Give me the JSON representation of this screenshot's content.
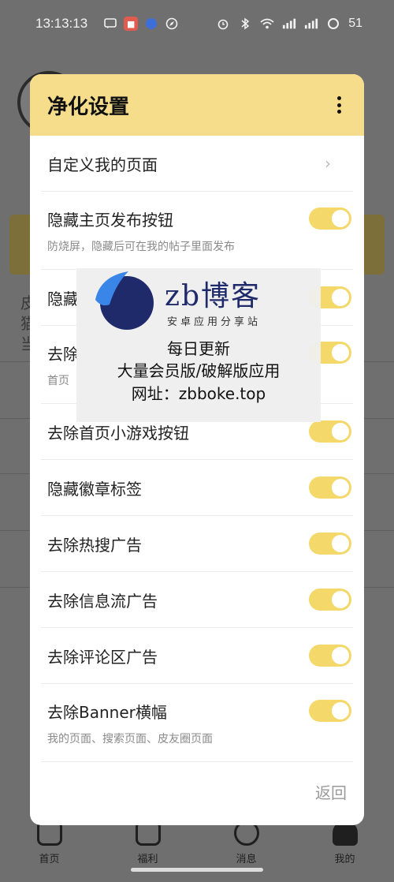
{
  "status_bar": {
    "time": "13:13:13",
    "battery": "51"
  },
  "background_app": {
    "snippets": [
      "皮",
      "猫",
      "当"
    ],
    "nav": [
      {
        "label": "首页"
      },
      {
        "label": "福利"
      },
      {
        "label": "消息"
      },
      {
        "label": "我的"
      }
    ]
  },
  "dialog": {
    "title": "净化设置",
    "rows": [
      {
        "label": "自定义我的页面",
        "type": "link"
      },
      {
        "label": "隐藏主页发布按钮",
        "sub": "防烧屏，隐藏后可在我的帖子里面发布",
        "type": "toggle",
        "on": true
      },
      {
        "label": "隐藏",
        "type": "toggle",
        "on": true
      },
      {
        "label": "去除",
        "sub": "首页",
        "type": "toggle",
        "on": true
      },
      {
        "label": "去除首页小游戏按钮",
        "type": "toggle",
        "on": true
      },
      {
        "label": "隐藏徽章标签",
        "type": "toggle",
        "on": true
      },
      {
        "label": "去除热搜广告",
        "type": "toggle",
        "on": true
      },
      {
        "label": "去除信息流广告",
        "type": "toggle",
        "on": true
      },
      {
        "label": "去除评论区广告",
        "type": "toggle",
        "on": true
      },
      {
        "label": "去除Banner横幅",
        "sub": "我的页面、搜索页面、皮友圈页面",
        "type": "toggle",
        "on": true
      }
    ],
    "back_label": "返回"
  },
  "watermark": {
    "brand": "zb博客",
    "tagline": "安卓应用分享站",
    "line1": "每日更新",
    "line2": "大量会员版/破解版应用",
    "line3": "网址：zbboke.top"
  },
  "colors": {
    "header": "#f6dd8b",
    "toggle_on": "#f4d86a"
  }
}
